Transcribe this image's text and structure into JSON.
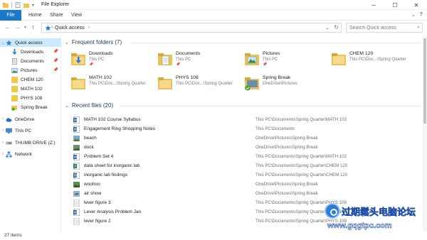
{
  "window": {
    "title": "File Explorer",
    "minimize": "─",
    "maximize": "☐",
    "close": "✕"
  },
  "ribbon": {
    "tabs": [
      "File",
      "Home",
      "Share",
      "View"
    ],
    "expand": "⌄",
    "help": "?"
  },
  "address": {
    "crumb": "Quick access",
    "search_placeholder": "Search Quick access"
  },
  "sidebar": {
    "quick_access": "Quick access",
    "pinned": [
      {
        "label": "Downloads",
        "icon": "downloads-icon"
      },
      {
        "label": "Documents",
        "icon": "documents-icon"
      },
      {
        "label": "Pictures",
        "icon": "pictures-icon"
      }
    ],
    "folders": [
      "CHEM 120",
      "MATH 102",
      "PHYS 108",
      "Spring Break"
    ],
    "roots": [
      {
        "label": "OneDrive",
        "icon": "onedrive-icon"
      },
      {
        "label": "This PC",
        "icon": "this-pc-icon"
      },
      {
        "label": "THUMB DRIVE (Z:)",
        "icon": "usb-drive-icon"
      },
      {
        "label": "Network",
        "icon": "network-icon"
      }
    ]
  },
  "frequent": {
    "header": "Frequent folders (7)",
    "tiles": [
      {
        "name": "Downloads",
        "path": "This PC",
        "pinned": true,
        "icon": "downloads-folder-icon"
      },
      {
        "name": "Documents",
        "path": "This PC",
        "pinned": true,
        "icon": "documents-folder-icon"
      },
      {
        "name": "Pictures",
        "path": "This PC",
        "pinned": true,
        "icon": "pictures-folder-icon"
      },
      {
        "name": "CHEM 120",
        "path": "This PC\\Doc...\\Spring Quarter",
        "pinned": false,
        "icon": "folder-icon"
      },
      {
        "name": "MATH 102",
        "path": "This PC\\Doc...\\Spring Quarter",
        "pinned": false,
        "icon": "folder-icon"
      },
      {
        "name": "PHYS 108",
        "path": "This PC\\Doc...\\Spring Quarter",
        "pinned": false,
        "icon": "folder-icon"
      },
      {
        "name": "Spring Break",
        "path": "OneDrive\\Pictures",
        "pinned": false,
        "icon": "synced-folder-icon"
      }
    ]
  },
  "recent": {
    "header": "Recent files (20)",
    "files": [
      {
        "name": "MATH 102 Course Syllabus",
        "path": "This PC\\Documents\\Spring Quarter\\MATH 102",
        "type": "word"
      },
      {
        "name": "Engagement Ring Shopping Notes",
        "path": "This PC\\Documents",
        "type": "word"
      },
      {
        "name": "beach",
        "path": "OneDrive\\Pictures\\Spring Break",
        "type": "image"
      },
      {
        "name": "dock",
        "path": "OneDrive\\Pictures\\Spring Break",
        "type": "image"
      },
      {
        "name": "Problem Set 4",
        "path": "This PC\\Documents\\Spring Quarter\\MATH 102",
        "type": "word"
      },
      {
        "name": "data sheet for inorganic lab",
        "path": "This PC\\Documents\\Spring Quarter\\CHEM 120",
        "type": "excel"
      },
      {
        "name": "inorganic lab findings",
        "path": "This PC\\Documents\\Spring Quarter\\CHEM 120",
        "type": "word"
      },
      {
        "name": "woohoo",
        "path": "OneDrive\\Pictures\\Spring Break",
        "type": "image"
      },
      {
        "name": "air show",
        "path": "OneDrive\\Pictures\\Spring Break",
        "type": "image"
      },
      {
        "name": "lever figure 3",
        "path": "This PC\\Documents\\Spring Quarter\\PHYS 108",
        "type": "doc"
      },
      {
        "name": "Lever Analysis Problem Jan",
        "path": "This PC\\Documents\\Spring Quarter\\PHYS 108",
        "type": "word"
      },
      {
        "name": "lever figure 2",
        "path": "This PC\\Documents\\Spring Quarter\\PHYS 108",
        "type": "doc"
      }
    ]
  },
  "status": {
    "count": "27 items"
  },
  "watermark": {
    "line1": "过期鬆头电脑论坛",
    "line2": "www.gqgtpc.com"
  }
}
